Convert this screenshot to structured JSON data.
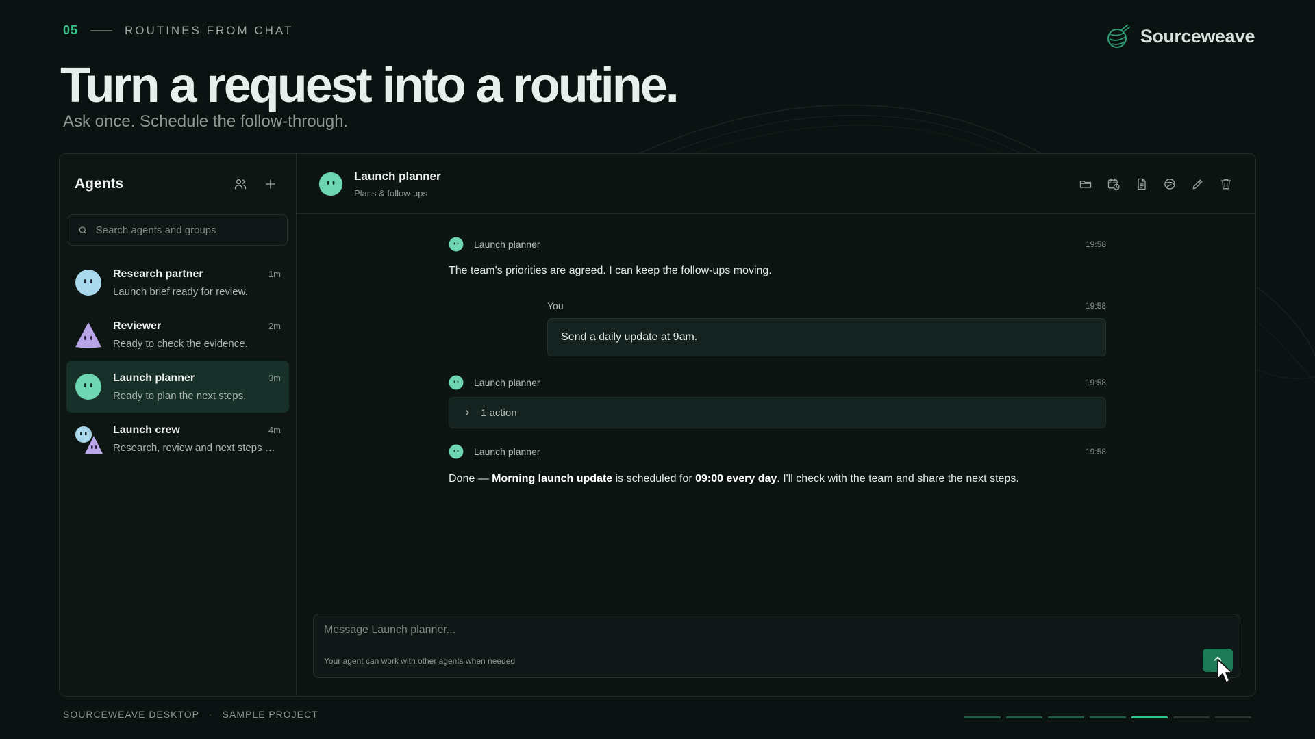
{
  "slide": {
    "number": "05",
    "section": "ROUTINES FROM CHAT",
    "headline": "Turn a request into a routine.",
    "subheadline": "Ask once. Schedule the follow-through.",
    "brand": "Sourceweave",
    "current_step": 5,
    "total_steps": 7
  },
  "colors": {
    "accent": "#35c38a",
    "active_item": "#17302a",
    "send_button": "#1d7a56",
    "agent_teal": "#6fd6b4",
    "agent_blue": "#a9d8ec",
    "agent_purple": "#b9a6e8"
  },
  "sidebar": {
    "title": "Agents",
    "icons": [
      "group-icon",
      "plus-icon"
    ],
    "search_placeholder": "Search agents and groups",
    "agents": [
      {
        "name": "Research partner",
        "time": "1m",
        "preview": "Launch brief ready for review."
      },
      {
        "name": "Reviewer",
        "time": "2m",
        "preview": "Ready to check the evidence."
      },
      {
        "name": "Launch planner",
        "time": "3m",
        "preview": "Ready to plan the next steps."
      },
      {
        "name": "Launch crew",
        "time": "4m",
        "preview": "Research, review and next steps — t..."
      }
    ]
  },
  "chat": {
    "title": "Launch planner",
    "subtitle": "Plans & follow-ups",
    "toolbar_icons": [
      "folder-icon",
      "calendar-clock-icon",
      "document-icon",
      "globe-icon",
      "pencil-icon",
      "trash-icon"
    ],
    "messages": [
      {
        "sender": "Launch planner",
        "time": "19:58",
        "text": "The team's priorities are agreed. I can keep the follow-ups moving."
      },
      {
        "sender": "You",
        "time": "19:58",
        "text": "Send a daily update at 9am."
      },
      {
        "sender": "Launch planner",
        "time": "19:58",
        "action": "1 action"
      },
      {
        "sender": "Launch planner",
        "time": "19:58",
        "parts": {
          "prefix": "Done — ",
          "routine_name": "Morning launch update",
          "middle": " is scheduled for ",
          "schedule": "09:00 every day",
          "suffix": ". I'll check with the team and share the next steps."
        }
      }
    ],
    "composer_placeholder": "Message Launch planner...",
    "composer_hint": "Your agent can work with other agents when needed"
  },
  "footer": {
    "product": "SOURCEWEAVE DESKTOP",
    "separator": "·",
    "project": "SAMPLE PROJECT"
  }
}
